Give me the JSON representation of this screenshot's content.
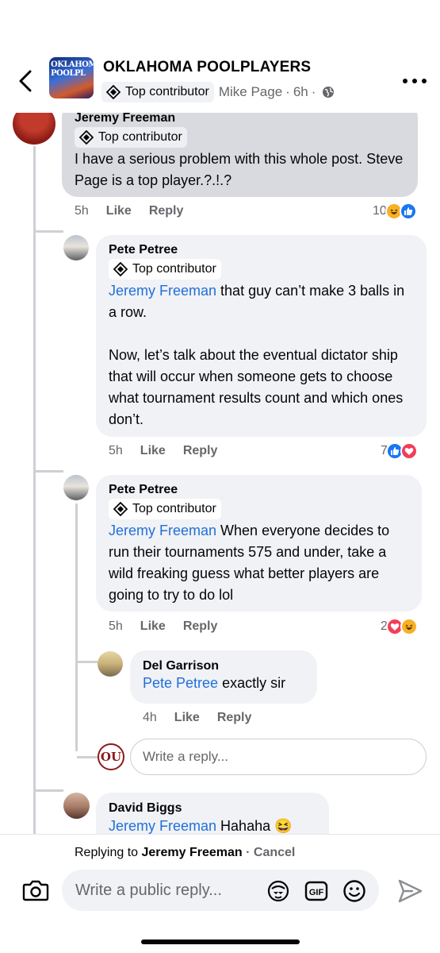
{
  "header": {
    "group_name": "OKLAHOMA POOLPLAYERS",
    "avatar_text": "OKLAHOMA POOLPL",
    "badge": "Top contributor",
    "author": "Mike Page",
    "separator": "·",
    "time": "6h",
    "separator2": "·",
    "icons": {
      "back": "chevron-left-icon",
      "more": "more-horizontal-icon",
      "privacy": "globe-icon"
    }
  },
  "comments": [
    {
      "author": "Jeremy Freeman",
      "badge": "Top contributor",
      "text": "I have a serious problem with this whole post. Steve Page is a top player.?.!.?",
      "time": "5h",
      "like": "Like",
      "reply": "Reply",
      "reaction_count": "10",
      "reactions": [
        "haha",
        "like"
      ]
    },
    {
      "author": "Pete Petree",
      "badge": "Top contributor",
      "mention": "Jeremy Freeman",
      "text_line1": " that guy can’t make 3 balls in a row.",
      "text_line2": "Now, let’s talk about the eventual dictator ship that will occur when someone gets to choose what tournament results count and which ones don’t.",
      "time": "5h",
      "like": "Like",
      "reply": "Reply",
      "reaction_count": "7",
      "reactions": [
        "like",
        "love"
      ]
    },
    {
      "author": "Pete Petree",
      "badge": "Top contributor",
      "mention": "Jeremy Freeman",
      "text": " When everyone decides to run their tournaments 575 and under, take a wild freaking guess what better players are going to try to do lol",
      "time": "5h",
      "like": "Like",
      "reply": "Reply",
      "reaction_count": "2",
      "reactions": [
        "love",
        "haha"
      ]
    },
    {
      "author": "Del Garrison",
      "mention": "Pete Petree",
      "text": " exactly sir",
      "time": "4h",
      "like": "Like",
      "reply": "Reply"
    },
    {
      "author": "David Biggs",
      "mention": "Jeremy Freeman",
      "text": " Hahaha 😆"
    }
  ],
  "reply_box": {
    "placeholder": "Write a reply...",
    "avatar_text": "OU"
  },
  "composer": {
    "replying_prefix": "Replying to ",
    "replying_to": "Jeremy Freeman",
    "dot": " · ",
    "cancel": "Cancel",
    "placeholder": "Write a public reply...",
    "gif_label": "GIF",
    "icons": [
      "camera-icon",
      "avatar-sticker-icon",
      "gif-icon",
      "emoji-icon",
      "send-icon"
    ]
  },
  "colors": {
    "mention": "#216fdb",
    "bubble": "#f0f2f5",
    "bubble_highlight": "#d8dadf",
    "muted": "#65676b",
    "like": "#1877f2",
    "love": "#f33e58",
    "haha": "#f7b125"
  }
}
